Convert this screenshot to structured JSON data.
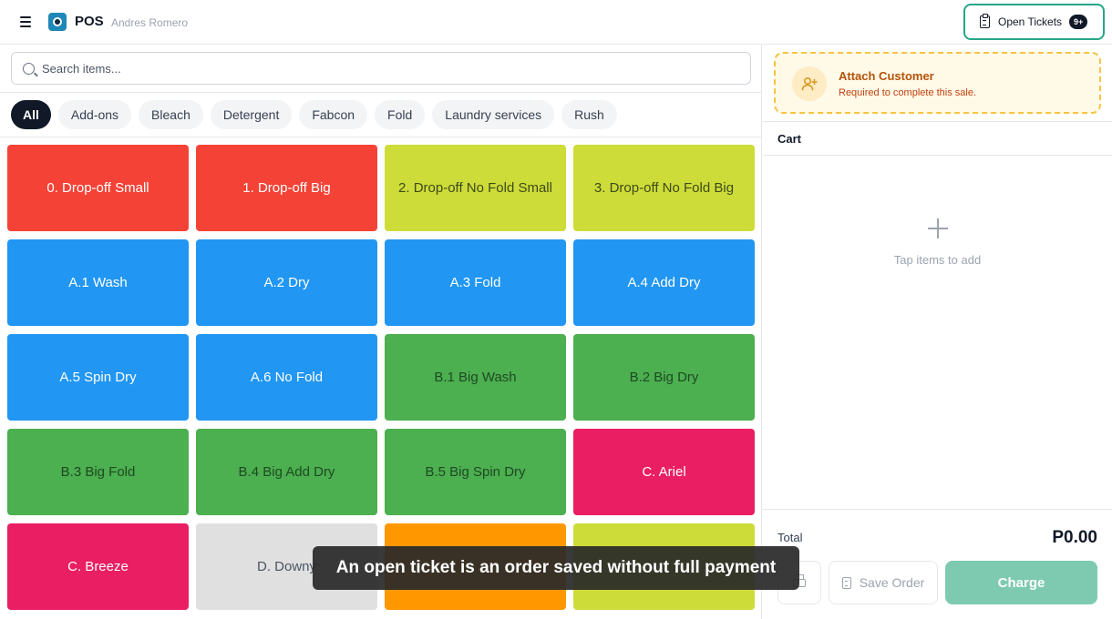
{
  "header": {
    "menu_icon": "hamburger-menu-icon",
    "app_title": "POS",
    "user_name": "Andres Romero",
    "open_tickets_label": "Open Tickets",
    "open_tickets_badge": "9+",
    "accent_color": "#26a68a"
  },
  "search": {
    "placeholder": "Search items..."
  },
  "categories": [
    "All",
    "Add-ons",
    "Bleach",
    "Detergent",
    "Fabcon",
    "Fold",
    "Laundry services",
    "Rush"
  ],
  "active_category": "All",
  "items": [
    {
      "label": "0. Drop-off Small",
      "color": "#f44336"
    },
    {
      "label": "1. Drop-off Big",
      "color": "#f44336"
    },
    {
      "label": "2. Drop-off No Fold Small",
      "color": "#cddc39"
    },
    {
      "label": "3. Drop-off No Fold Big",
      "color": "#cddc39"
    },
    {
      "label": "A.1 Wash",
      "color": "#2196f3"
    },
    {
      "label": "A.2 Dry",
      "color": "#2196f3"
    },
    {
      "label": "A.3 Fold",
      "color": "#2196f3"
    },
    {
      "label": "A.4 Add Dry",
      "color": "#2196f3"
    },
    {
      "label": "A.5 Spin Dry",
      "color": "#2196f3"
    },
    {
      "label": "A.6 No Fold",
      "color": "#2196f3"
    },
    {
      "label": "B.1 Big Wash",
      "color": "#4caf50"
    },
    {
      "label": "B.2 Big Dry",
      "color": "#4caf50"
    },
    {
      "label": "B.3 Big Fold",
      "color": "#4caf50"
    },
    {
      "label": "B.4 Big Add Dry",
      "color": "#4caf50"
    },
    {
      "label": "B.5 Big Spin Dry",
      "color": "#4caf50"
    },
    {
      "label": "C. Ariel",
      "color": "#e91e63"
    },
    {
      "label": "C. Breeze",
      "color": "#e91e63"
    },
    {
      "label": "D. Downy",
      "color": "#e0e0e0"
    },
    {
      "label": "",
      "color": "#ff9800"
    },
    {
      "label": "",
      "color": "#cddc39"
    }
  ],
  "attach_customer": {
    "title": "Attach Customer",
    "subtitle": "Required to complete this sale.",
    "icon": "user-plus-icon"
  },
  "cart": {
    "title": "Cart",
    "empty_text": "Tap items to add",
    "total_label": "Total",
    "total_value": "P0.00",
    "save_label": "Save Order",
    "charge_label": "Charge"
  },
  "tooltip": {
    "text": "An open ticket is an order saved without full payment"
  }
}
